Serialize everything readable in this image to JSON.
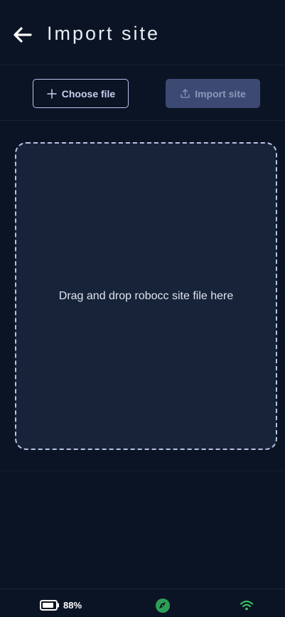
{
  "header": {
    "title": "Import site",
    "back_icon": "arrow-left-icon"
  },
  "toolbar": {
    "choose_label": "Choose file",
    "choose_icon": "plus-icon",
    "import_label": "Import site",
    "import_icon": "upload-icon",
    "import_enabled": false
  },
  "dropzone": {
    "text": "Drag and drop robocc site file here"
  },
  "status": {
    "battery_label": "88%",
    "battery_level": 0.88,
    "battery_icon": "battery-icon",
    "compass_icon": "compass-icon",
    "wifi_icon": "wifi-icon",
    "colors": {
      "compass": "#2e9e56",
      "wifi": "#3ecf6b"
    }
  },
  "colors": {
    "background": "#0b1424",
    "dropzone": "#172339",
    "accent": "#b9c3e8",
    "import_disabled": "#3c4a73"
  }
}
